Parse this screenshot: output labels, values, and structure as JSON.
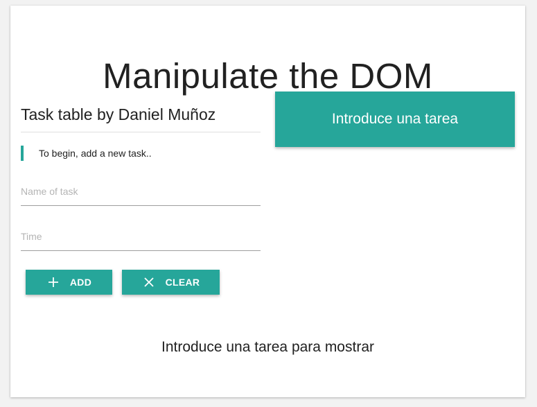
{
  "page": {
    "title": "Manipulate the DOM"
  },
  "task_table": {
    "heading": "Task table by Daniel Muñoz",
    "info_note": "To begin, add a new task..",
    "name_field": {
      "value": "",
      "placeholder": "Name of task"
    },
    "time_field": {
      "value": "",
      "placeholder": "Time"
    },
    "add_button": {
      "icon": "plus-icon",
      "label": "ADD"
    },
    "clear_button": {
      "icon": "close-icon",
      "label": "CLEAR"
    }
  },
  "main_button": {
    "label": "Introduce una tarea"
  },
  "empty_state": {
    "message": "Introduce una tarea para mostrar"
  },
  "colors": {
    "accent": "#26a69a",
    "text": "#212121",
    "divider": "#e0e0e0",
    "underline": "#9e9e9e",
    "placeholder": "#b4b4b4"
  }
}
